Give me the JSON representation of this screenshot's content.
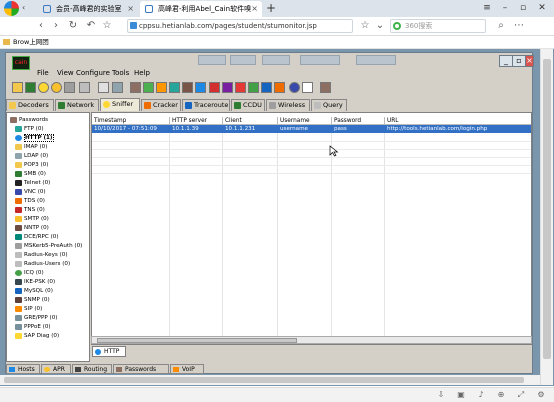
{
  "browser": {
    "tabs": [
      {
        "title": "会员-高峰君的实验室"
      },
      {
        "title": "高峰君-利用Abel_Cain软件嗅"
      }
    ],
    "new_tab": "+",
    "url": "cppsu.hetianlab.com/pages/student/stumonitor.jsp",
    "search_placeholder": "360搜索",
    "bookmark": "Brow上网团"
  },
  "cain": {
    "logo": "cain",
    "menu": [
      "File",
      "View",
      "Configure",
      "Tools",
      "Help"
    ],
    "tabs": [
      "Decoders",
      "Network",
      "Sniffer",
      "Cracker",
      "Traceroute",
      "CCDU",
      "Wireless",
      "Query"
    ],
    "active_tab": "Sniffer",
    "tree_root": "Passwords",
    "tree": [
      "FTP (0)",
      "HTTP (1)",
      "IMAP (0)",
      "LDAP (0)",
      "POP3 (0)",
      "SMB (0)",
      "Telnet (0)",
      "VNC (0)",
      "TDS (0)",
      "TNS (0)",
      "SMTP (0)",
      "NNTP (0)",
      "DCE/RPC (0)",
      "MSKerb5-PreAuth (0)",
      "Radius-Keys (0)",
      "Radius-Users (0)",
      "ICQ (0)",
      "IKE-PSK (0)",
      "MySQL (0)",
      "SNMP (0)",
      "SIP (0)",
      "GRE/PPP (0)",
      "PPPoE (0)",
      "SAP Diag (0)"
    ],
    "selected_tree": "HTTP (1)",
    "table": {
      "headers": [
        "Timestamp",
        "HTTP server",
        "Client",
        "Username",
        "Password",
        "URL"
      ],
      "rows": [
        [
          "10/10/2017 - 07:51:09",
          "10.1.1.39",
          "10.1.1.231",
          "username",
          "pass",
          "http://tools.hetianlab.com/login.php"
        ]
      ]
    },
    "sub_tab": "HTTP",
    "bottom_tabs": [
      "Hosts",
      "APR",
      "Routing",
      "Passwords",
      "VoIP"
    ]
  }
}
